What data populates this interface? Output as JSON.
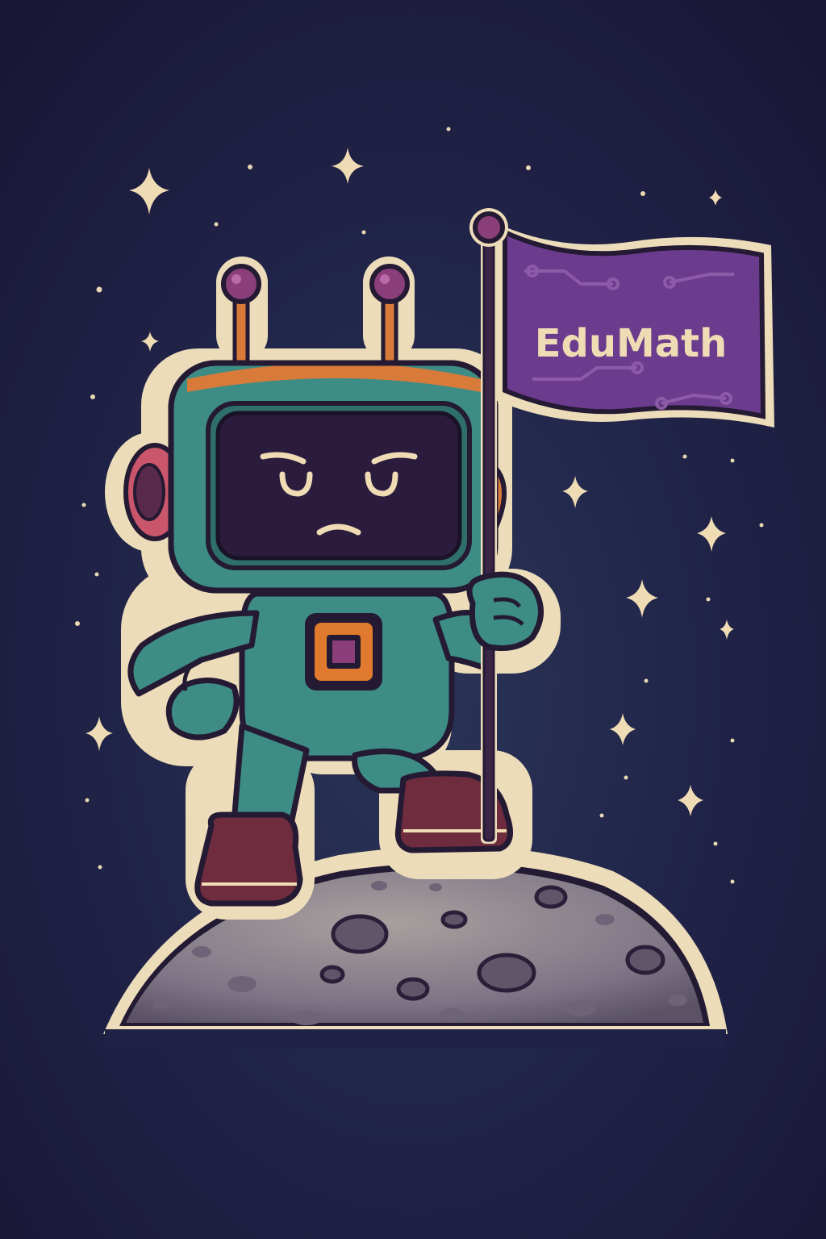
{
  "flag": {
    "text": "EduMath"
  },
  "icons": {
    "stars": "sparkle-star-icon",
    "robot": "robot-astronaut-icon",
    "moon": "moon-icon",
    "flag": "flag-icon"
  },
  "colors": {
    "background": "#1d1a3a",
    "outline": "#f2e3c4",
    "ink": "#241a33",
    "robot_teal": "#3e8c86",
    "robot_teal_dark": "#2f6f6b",
    "screen": "#2b1b3d",
    "accent_orange": "#e07a2e",
    "accent_purple": "#8a3f7a",
    "flag_purple": "#6b3c8e",
    "boot_maroon": "#6e2c3e",
    "moon_gray": "#8a8290",
    "crater": "#5d5566"
  }
}
